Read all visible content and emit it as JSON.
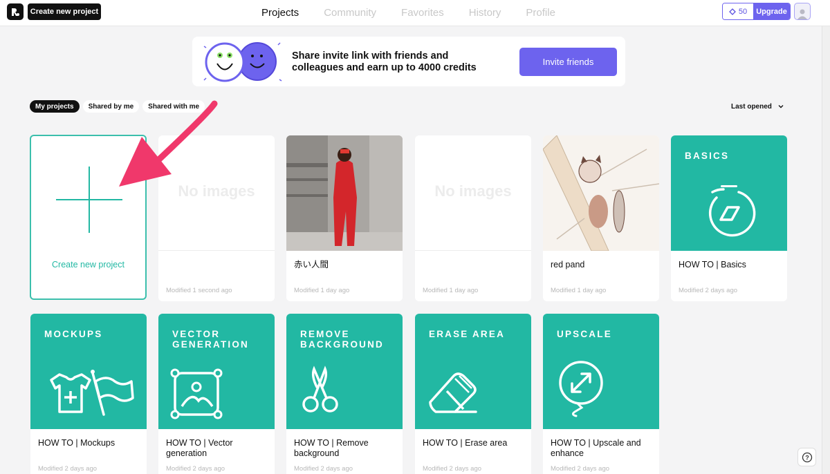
{
  "topbar": {
    "create_label": "Create new project",
    "nav": [
      "Projects",
      "Community",
      "Favorites",
      "History",
      "Profile"
    ],
    "active_nav": "Projects",
    "credits": "50",
    "upgrade_label": "Upgrade"
  },
  "banner": {
    "text": "Share invite link with friends and colleagues and earn up to 4000 credits",
    "button": "Invite friends"
  },
  "filters": {
    "chips": [
      "My projects",
      "Shared by me",
      "Shared with me"
    ],
    "active": "My projects",
    "sort": "Last opened"
  },
  "create_card": {
    "label": "Create new project"
  },
  "projects": [
    {
      "title": "",
      "placeholder": "No images",
      "modified": "Modified 1 second ago"
    },
    {
      "title": "赤い人間",
      "modified": "Modified 1 day ago"
    },
    {
      "title": "",
      "placeholder": "No images",
      "modified": "Modified 1 day ago"
    },
    {
      "title": "red pand",
      "modified": "Modified 1 day ago"
    },
    {
      "title": "HOW TO | Basics",
      "tile": "BASICS",
      "icon": "stopwatch-icon",
      "modified": "Modified 2 days ago"
    }
  ],
  "tutorials": [
    {
      "tile": "MOCKUPS",
      "icon": "tshirt-flag-icon",
      "title": "HOW TO | Mockups",
      "modified": "Modified 2 days ago"
    },
    {
      "tile": "VECTOR\nGENERATION",
      "icon": "vector-image-icon",
      "title": "HOW TO | Vector generation",
      "modified": "Modified 2 days ago"
    },
    {
      "tile": "REMOVE\nBACKGROUND",
      "icon": "scissors-icon",
      "title": "HOW TO | Remove background",
      "modified": "Modified 2 days ago"
    },
    {
      "tile": "ERASE AREA",
      "icon": "eraser-icon",
      "title": "HOW TO | Erase area",
      "modified": "Modified 2 days ago"
    },
    {
      "tile": "UPSCALE",
      "icon": "upscale-balloon-icon",
      "title": "HOW TO | Upscale and enhance",
      "modified": "Modified 2 days ago"
    }
  ],
  "colors": {
    "teal": "#22b8a3",
    "accent": "#6d63ee",
    "arrow": "#f0386b"
  },
  "help": "?"
}
